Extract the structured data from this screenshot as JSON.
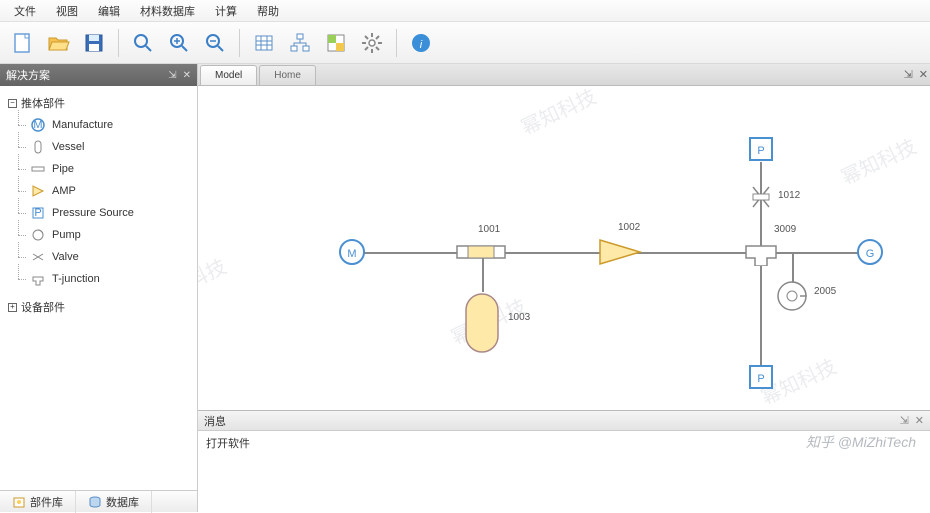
{
  "menu": {
    "items": [
      "文件",
      "视图",
      "编辑",
      "材料数据库",
      "计算",
      "帮助"
    ]
  },
  "toolbar_icons": [
    "new-doc",
    "open-folder",
    "save",
    "zoom-in-find",
    "zoom-in",
    "zoom-out",
    "grid-table",
    "org-chart",
    "color-swatch",
    "settings-gear",
    "info"
  ],
  "sidebar": {
    "title": "解决方案",
    "cat1": "推体部件",
    "cat2": "设备部件",
    "items": [
      {
        "label": "Manufacture"
      },
      {
        "label": "Vessel"
      },
      {
        "label": "Pipe"
      },
      {
        "label": "AMP"
      },
      {
        "label": "Pressure Source"
      },
      {
        "label": "Pump"
      },
      {
        "label": "Valve"
      },
      {
        "label": "T-junction"
      }
    ]
  },
  "tabs": {
    "active": "Model",
    "inactive": "Home"
  },
  "canvas": {
    "nodes": {
      "M": {
        "label": "M"
      },
      "G": {
        "label": "G"
      },
      "P1": {
        "label": "P"
      },
      "P2": {
        "label": "P"
      },
      "n1001": "1001",
      "n1002": "1002",
      "n1003": "1003",
      "n1012": "1012",
      "n2005": "2005",
      "n3009": "3009"
    }
  },
  "messages": {
    "title": "消息",
    "line1": "打开软件"
  },
  "bottom": {
    "tab1": "部件库",
    "tab2": "数据库"
  },
  "panel_ctl": {
    "pin": "⇲",
    "close": "✕"
  },
  "watermark_text": "幂知科技",
  "attribution": "知乎 @MiZhiTech"
}
